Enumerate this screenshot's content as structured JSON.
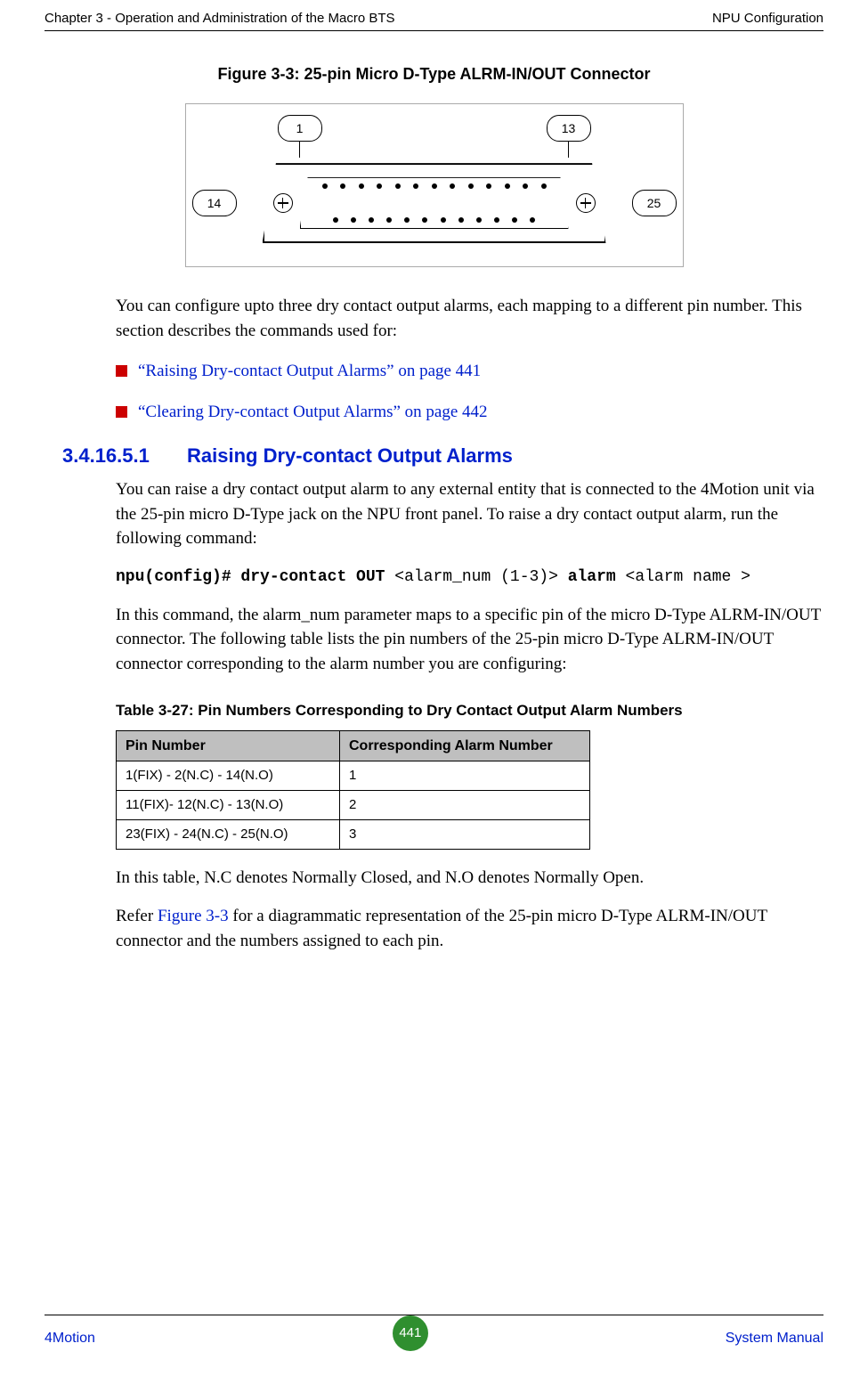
{
  "header": {
    "left": "Chapter 3 - Operation and Administration of the Macro BTS",
    "right": "NPU Configuration"
  },
  "figure": {
    "caption": "Figure 3-3: 25-pin Micro D-Type ALRM-IN/OUT Connector",
    "pins": {
      "tl": "1",
      "tr": "13",
      "bl": "14",
      "br": "25"
    }
  },
  "intro": {
    "p1": "You can configure upto three dry contact output alarms, each mapping to a different pin number. This section describes the commands used for:"
  },
  "bullets": {
    "b1": "“Raising Dry-contact Output Alarms” on page 441",
    "b2": "“Clearing Dry-contact Output Alarms” on page 442"
  },
  "section": {
    "num": "3.4.16.5.1",
    "title": "Raising Dry-contact Output Alarms",
    "p1": "You can raise a dry contact output alarm to any external entity that is connected to the 4Motion unit via the 25-pin micro D-Type jack on the NPU front panel. To raise a dry contact output alarm, run the following command:",
    "cmd_bold1": "npu(config)# dry-contact OUT ",
    "cmd_arg1": "<alarm_num (1-3)>",
    "cmd_bold2": " alarm ",
    "cmd_arg2": "<alarm name >",
    "p2": "In this command, the alarm_num parameter maps to a specific pin of the micro D-Type ALRM-IN/OUT connector. The following table lists the pin numbers of the 25-pin micro D-Type ALRM-IN/OUT connector corresponding to the alarm number you are configuring:"
  },
  "table": {
    "caption": "Table 3-27: Pin Numbers Corresponding to Dry Contact Output Alarm Numbers",
    "headers": {
      "c1": "Pin Number",
      "c2": "Corresponding Alarm Number"
    },
    "rows": [
      {
        "c1": "1(FIX) - 2(N.C) - 14(N.O)",
        "c2": "1"
      },
      {
        "c1": "11(FIX)- 12(N.C) - 13(N.O)",
        "c2": "2"
      },
      {
        "c1": "23(FIX) - 24(N.C) - 25(N.O)",
        "c2": "3"
      }
    ]
  },
  "after_table": {
    "p1": "In this table, N.C denotes Normally Closed, and N.O denotes Normally Open.",
    "p2a": "Refer ",
    "p2link": "Figure 3-3",
    "p2b": " for a diagrammatic representation of the 25-pin micro D-Type ALRM-IN/OUT connector and the numbers assigned to each pin."
  },
  "footer": {
    "left": "4Motion",
    "page": "441",
    "right": "System Manual"
  }
}
